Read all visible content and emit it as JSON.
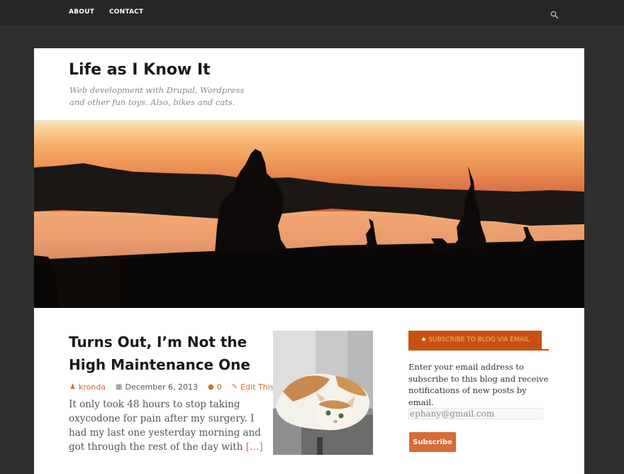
{
  "top_nav": {
    "items": [
      {
        "label": "ABOUT"
      },
      {
        "label": "CONTACT"
      }
    ],
    "search_icon": "search-icon"
  },
  "site": {
    "title": "Life as I Know It",
    "tagline": "Web development with Drupal, Wordpress and other fun toys. Also, bikes and cats."
  },
  "post": {
    "title": "Turns Out, I’m Not the High Maintenance One",
    "author": "kronda",
    "date": "December 6, 2013",
    "comments": "0",
    "edit_label": "Edit This",
    "excerpt": "It only took 48 hours to stop taking oxycodone for pain after my surgery. I had my last one yesterday morning and got through the rest of the day with",
    "more": "[…]"
  },
  "widget": {
    "title": "SUBSCRIBE TO BLOG VIA EMAIL",
    "text": "Enter your email address to subscribe to this blog and receive notifications of new posts by email.",
    "email_value": "ephany@gmail.com",
    "subscribe_label": "Subscribe"
  },
  "colors": {
    "accent": "#d86b36",
    "widget_header": "#c85111",
    "topbar": "#262626",
    "background": "#2f2f2f"
  }
}
